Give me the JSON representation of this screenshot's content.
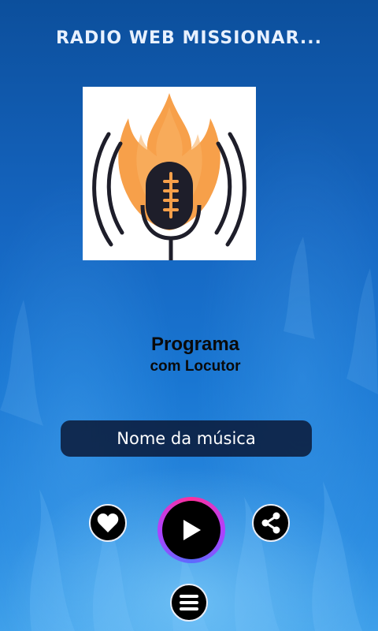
{
  "header": {
    "title": "RADIO WEB MISSIONAR..."
  },
  "program": {
    "name": "Programa",
    "host": "com Locutor"
  },
  "player": {
    "song_title": "Nome da música"
  },
  "icons": {
    "like": "heart-icon",
    "play": "play-icon",
    "share": "share-icon",
    "menu": "menu-icon"
  },
  "colors": {
    "logo_flame": "#f7a04a",
    "logo_dark": "#1e1e2a",
    "play_ring": "#ff2f9a"
  }
}
